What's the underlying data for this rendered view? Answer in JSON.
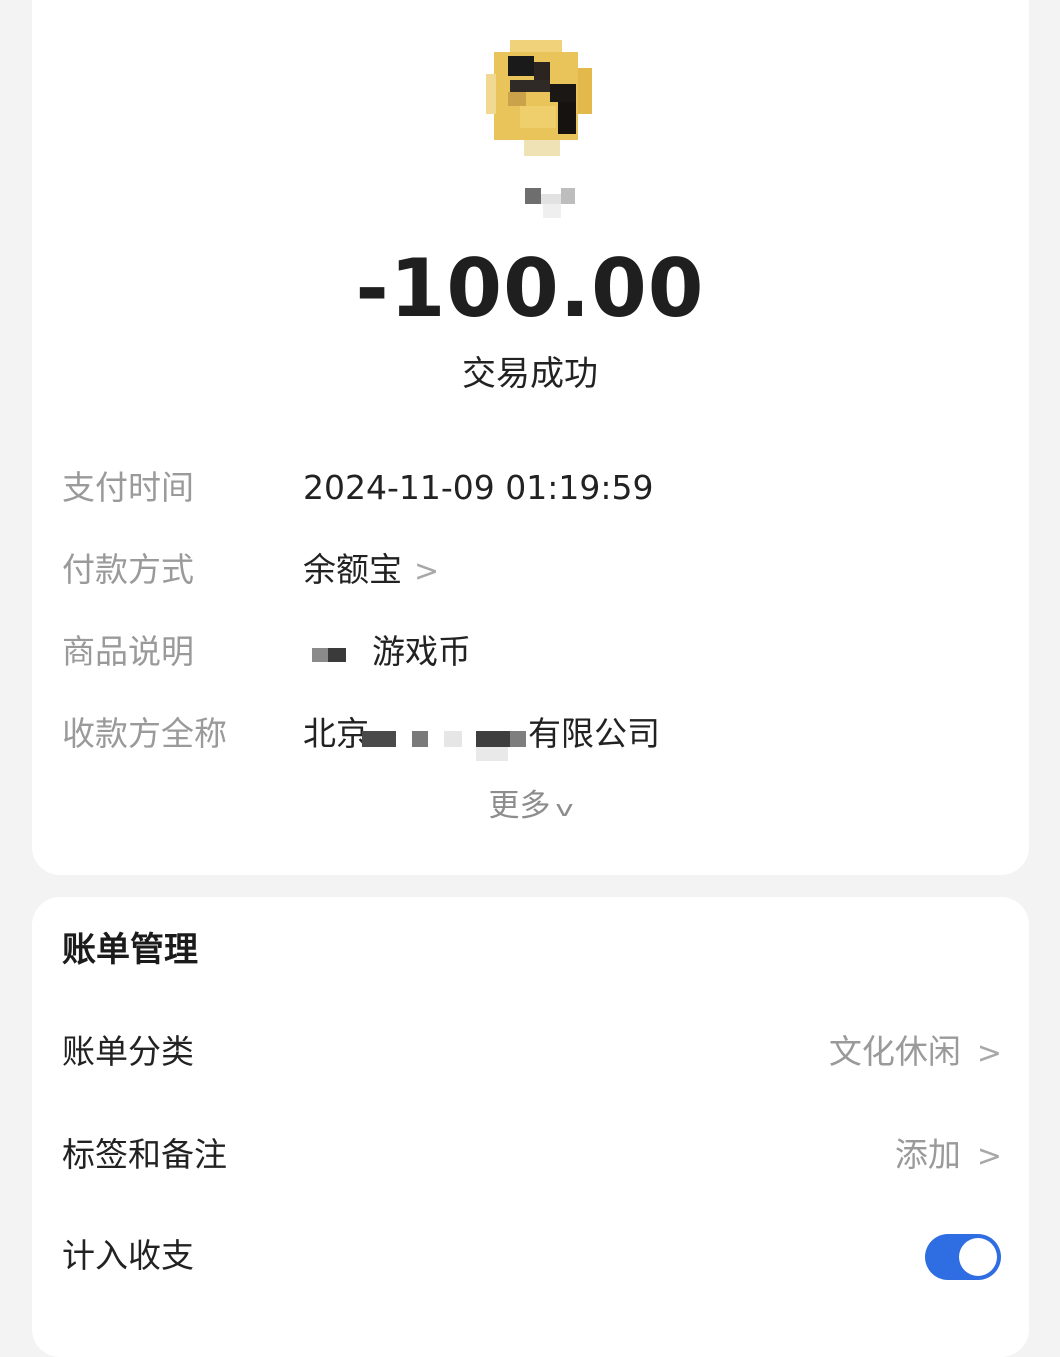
{
  "transaction": {
    "amount": "-100.00",
    "status": "交易成功"
  },
  "details": {
    "pay_time_label": "支付时间",
    "pay_time_value": "2024-11-09 01:19:59",
    "pay_method_label": "付款方式",
    "pay_method_value": "余额宝",
    "product_label": "商品说明",
    "product_value": "游戏币",
    "payee_label": "收款方全称",
    "payee_prefix": "北京",
    "payee_suffix": "有限公司",
    "more_label": "更多"
  },
  "bill_management": {
    "title": "账单管理",
    "category_label": "账单分类",
    "category_value": "文化休闲",
    "tags_label": "标签和备注",
    "tags_value": "添加",
    "count_label": "计入收支",
    "count_enabled": true
  },
  "icons": {
    "chevron_right": "chevron-right-icon",
    "chevron_down": "chevron-down-icon"
  },
  "colors": {
    "toggle_on": "#2f6de2",
    "avatar_yellow": "#e9c45a"
  }
}
